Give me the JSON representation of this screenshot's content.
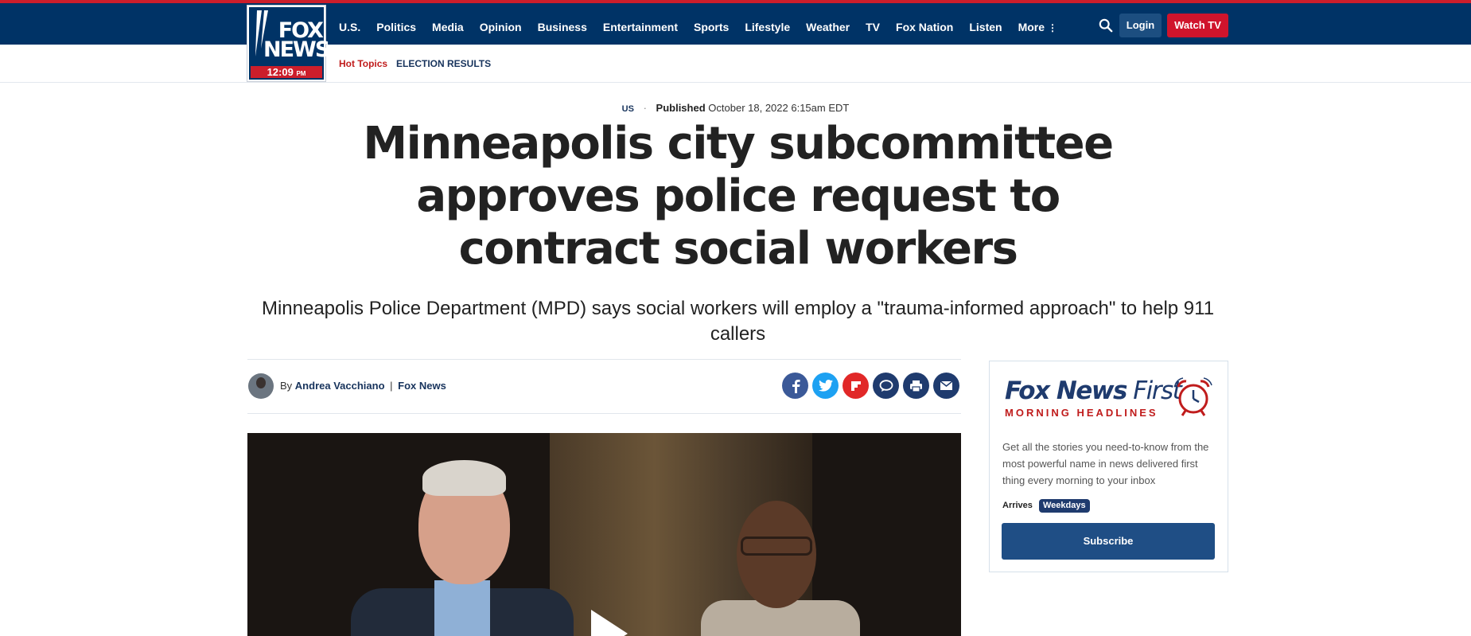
{
  "brand": {
    "logo_line1": "FOX",
    "logo_line2": "NEWS",
    "logo_time": "12:09",
    "logo_ampm": "PM",
    "accent_red": "#cc1e2b",
    "navy": "#003366"
  },
  "nav": {
    "items": [
      "U.S.",
      "Politics",
      "Media",
      "Opinion",
      "Business",
      "Entertainment",
      "Sports",
      "Lifestyle",
      "Weather",
      "TV",
      "Fox Nation",
      "Listen"
    ],
    "more_label": "More",
    "login_label": "Login",
    "watch_label": "Watch TV"
  },
  "subnav": {
    "hot_topics": "Hot Topics",
    "election": "ELECTION RESULTS"
  },
  "article": {
    "category": "US",
    "published_label": "Published",
    "published_date": "October 18, 2022 6:15am EDT",
    "headline": "Minneapolis city subcommittee approves police request to contract social workers",
    "subhead": "Minneapolis Police Department (MPD) says social workers will employ a \"trauma-informed approach\" to help 911 callers",
    "byline_prefix": "By",
    "author": "Andrea Vacchiano",
    "byline_sep": "|",
    "org": "Fox News"
  },
  "share": [
    {
      "name": "facebook-icon",
      "glyph": "f",
      "color": "#3b5998"
    },
    {
      "name": "twitter-icon",
      "glyph": "t",
      "color": "#1da1f2"
    },
    {
      "name": "flipboard-icon",
      "glyph": "F",
      "color": "#e12828"
    },
    {
      "name": "comments-icon",
      "glyph": "c",
      "color": "#1f3b6e"
    },
    {
      "name": "print-icon",
      "glyph": "p",
      "color": "#1f3b6e"
    },
    {
      "name": "email-icon",
      "glyph": "e",
      "color": "#1f3b6e"
    }
  ],
  "newsletter": {
    "brand_bold": "Fox News",
    "brand_light": "First",
    "tagline": "MORNING HEADLINES",
    "description": "Get all the stories you need-to-know from the most powerful name in news delivered first thing every morning to your inbox",
    "arrives_label": "Arrives",
    "frequency": "Weekdays",
    "subscribe_label": "Subscribe"
  }
}
